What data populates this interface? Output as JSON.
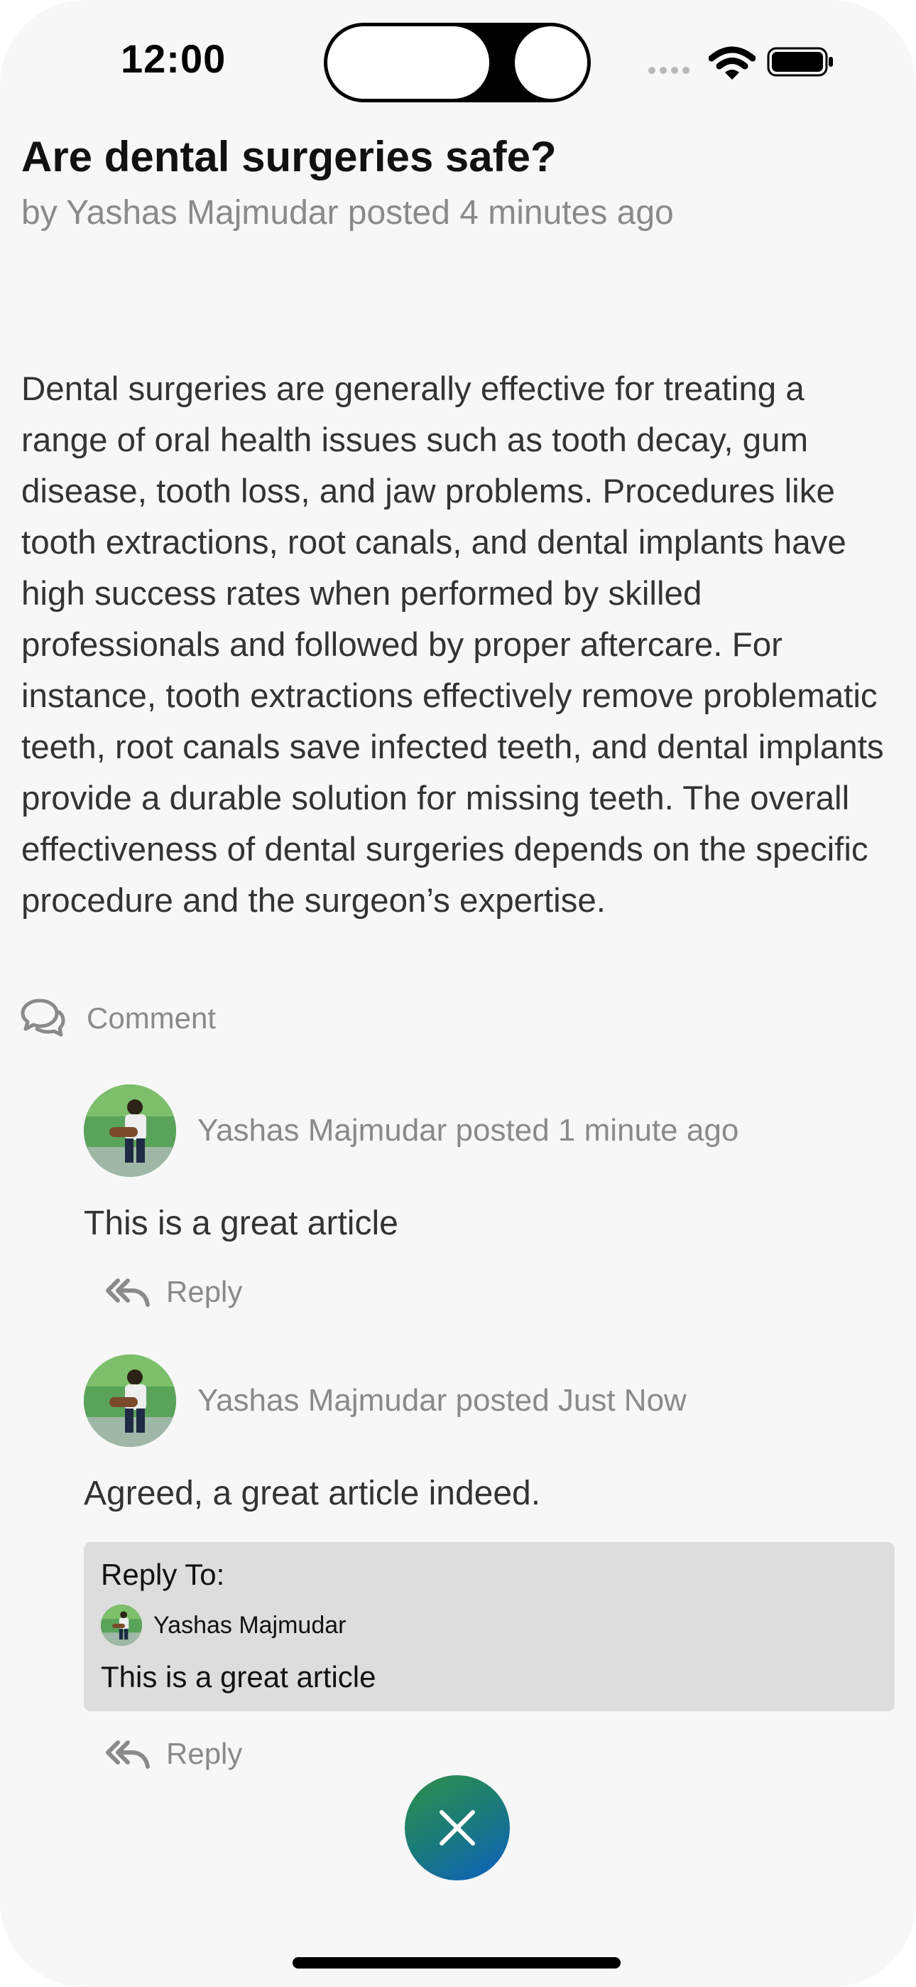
{
  "status_bar": {
    "time": "12:00"
  },
  "article": {
    "title": "Are dental surgeries safe?",
    "byline": "by Yashas Majmudar posted 4 minutes ago",
    "body": "Dental surgeries are generally effective for treating a range of oral health issues such as tooth decay, gum disease, tooth loss, and jaw problems. Procedures like tooth extractions, root canals, and dental implants have high success rates when performed by skilled professionals and followed by proper aftercare. For instance, tooth extractions effectively remove problematic teeth, root canals save infected teeth, and dental implants provide a durable solution for missing teeth. The overall effectiveness of dental surgeries depends on the specific procedure and the surgeon’s expertise.",
    "comment_label": "Comment"
  },
  "comments": [
    {
      "meta": "Yashas Majmudar posted 1 minute ago",
      "text": "This is a great article",
      "reply_label": "Reply"
    },
    {
      "meta": "Yashas Majmudar posted Just Now",
      "text": "Agreed, a great article indeed.",
      "reply_to": {
        "label": "Reply To:",
        "author": "Yashas Majmudar",
        "quote": "This is a great article"
      },
      "reply_label": "Reply"
    }
  ],
  "icons": {
    "comment": "comments-icon",
    "reply": "reply-all-icon",
    "close": "close-icon"
  },
  "colors": {
    "background": "#f7f7f7",
    "muted_text": "#8a8a8a",
    "reply_box": "#dddddd",
    "fab_gradient_start": "#2f8f4a",
    "fab_gradient_end": "#0d5fc0"
  }
}
